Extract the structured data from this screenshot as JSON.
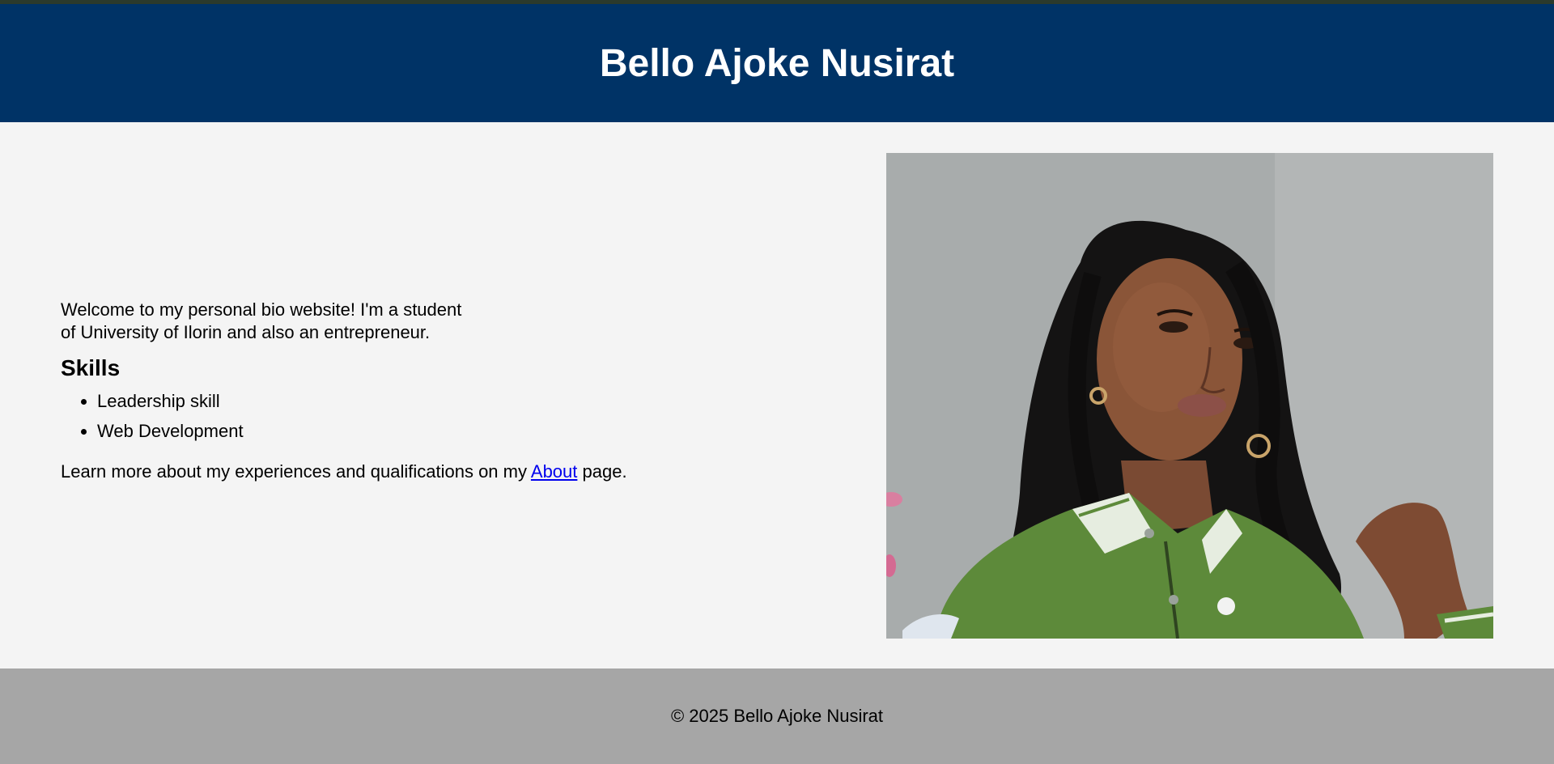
{
  "header": {
    "title": "Bello Ajoke Nusirat"
  },
  "main": {
    "intro_line1": "Welcome to my personal bio website! I'm a student",
    "intro_line2": "of University of Ilorin and also an entrepreneur.",
    "skills_heading": "Skills",
    "skills": [
      "Leadership skill",
      "Web Development"
    ],
    "learn_more_before": "Learn more about my experiences and qualifications on my ",
    "learn_more_link": "About",
    "learn_more_after": " page.",
    "photo_icon": "portrait-photo"
  },
  "footer": {
    "text": "© 2025 Bello Ajoke Nusirat"
  },
  "colors": {
    "header_bg": "#003366",
    "footer_bg": "#a6a6a6",
    "page_bg": "#f4f4f4",
    "link": "#0000ee"
  }
}
